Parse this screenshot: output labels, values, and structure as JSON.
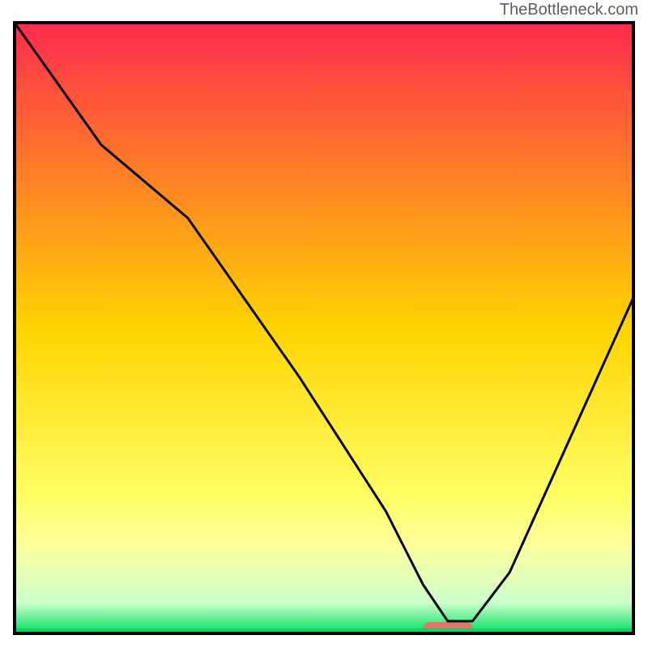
{
  "brand": "TheBottleneck.com",
  "chart_data": {
    "type": "line",
    "title": "",
    "xlabel": "",
    "ylabel": "",
    "xlim": [
      0,
      100
    ],
    "ylim": [
      0,
      100
    ],
    "gradient_stops": [
      {
        "offset": 0,
        "color": "#ff2b4d"
      },
      {
        "offset": 50,
        "color": "#ffd400"
      },
      {
        "offset": 78,
        "color": "#ffff66"
      },
      {
        "offset": 85,
        "color": "#ffff99"
      },
      {
        "offset": 95,
        "color": "#ccffcc"
      },
      {
        "offset": 100,
        "color": "#00e060"
      }
    ],
    "series": [
      {
        "name": "curve",
        "x": [
          0,
          14,
          28,
          46,
          60,
          66,
          70,
          74,
          80,
          88,
          100
        ],
        "y": [
          100,
          80,
          68,
          42,
          20,
          8,
          2,
          2,
          10,
          28,
          55
        ]
      }
    ],
    "marker": {
      "x_start": 66,
      "x_end": 74,
      "color": "#e2766d"
    },
    "plot_padding": 18
  }
}
